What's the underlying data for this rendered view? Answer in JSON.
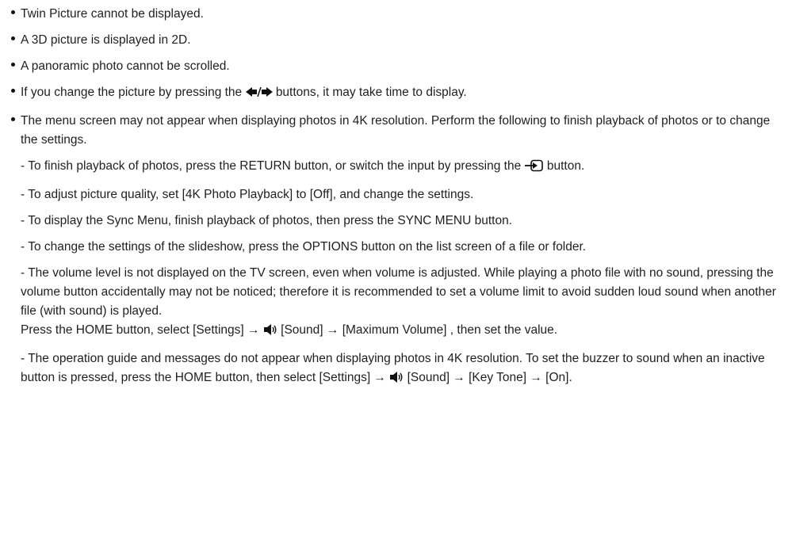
{
  "bullets": [
    "Twin Picture cannot be displayed.",
    "A 3D picture is displayed in 2D.",
    "A panoramic photo cannot be scrolled.",
    {
      "before": "If you change the picture by pressing the",
      "after": "buttons, it may take time to display.",
      "icon": "left-right-arrow-buttons-icon"
    },
    "The menu screen may not appear when displaying photos in 4K resolution. Perform the following to finish playback of photos or to change the settings."
  ],
  "notes": {
    "finish_playback": {
      "before": "- To finish playback of photos, press the RETURN button, or switch the input by pressing the",
      "after": "button.",
      "icon": "input-icon"
    },
    "picture_quality": "- To adjust picture quality, set [4K Photo Playback] to [Off], and change the settings.",
    "sync_menu": "- To display the Sync Menu, finish playback of photos, then press the SYNC MENU button.",
    "slideshow": "- To change the settings of the slideshow, press the OPTIONS button on the list screen of a file or folder.",
    "volume": "- The volume level is not displayed on the TV screen, even when volume is adjusted. While playing a photo file with no sound, pressing the volume button accidentally may not be noticed; therefore it is recommended to set a volume limit to avoid sudden loud sound when another file (with sound) is played.",
    "volume_steps": {
      "before": "Press the HOME button, select [Settings] →",
      "after": "[Sound] → [Maximum Volume] , then set the value.",
      "icon": "speaker-icon"
    },
    "guide": {
      "before": "- The operation guide and messages do not appear when displaying photos in 4K resolution. To set the buzzer to sound when an inactive button is pressed, press the HOME button, then select [Settings] →",
      "after": "[Sound] → [Key Tone] → [On].",
      "icon": "speaker-icon"
    }
  }
}
